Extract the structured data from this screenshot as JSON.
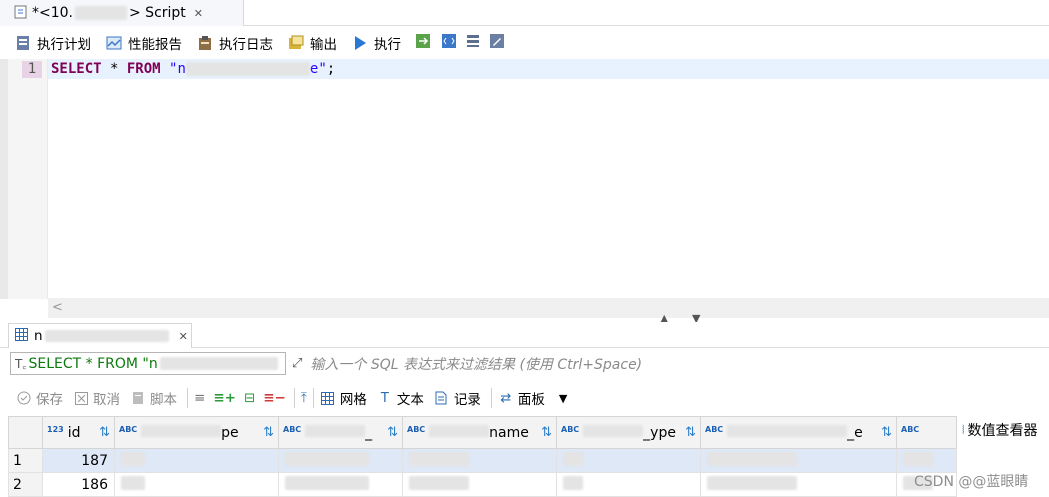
{
  "editor_tab": {
    "prefix": "*<10.",
    "suffix": "> Script",
    "close": "✕"
  },
  "toolbar": {
    "items": [
      {
        "label": "执行计划"
      },
      {
        "label": "性能报告"
      },
      {
        "label": "执行日志"
      },
      {
        "label": "输出"
      },
      {
        "label": "执行"
      }
    ]
  },
  "editor": {
    "line_number": "1",
    "code": {
      "kw1": "SELECT",
      "star": " * ",
      "kw2": "FROM",
      "q1": " \"n",
      "q2": "e\"",
      "semi": ";"
    }
  },
  "scroll": {
    "left_arrow": "<",
    "up": "▲",
    "down": "▼"
  },
  "result_tab": {
    "label_prefix": "n",
    "close": "✕"
  },
  "filter": {
    "text": "SELECT * FROM \"n",
    "placeholder": "输入一个 SQL 表达式来过滤结果 (使用 Ctrl+Space)"
  },
  "result_toolbar": {
    "save": "保存",
    "cancel": "取消",
    "script": "脚本",
    "grid": "网格",
    "text": "文本",
    "record": "记录",
    "panel": "面板"
  },
  "table": {
    "headers": [
      {
        "label": "id",
        "type": "123"
      },
      {
        "label": "pe",
        "type": "ABC"
      },
      {
        "label": "_",
        "type": "ABC"
      },
      {
        "label": "name",
        "type": "ABC"
      },
      {
        "label": "_ype",
        "type": "ABC"
      },
      {
        "label": "_e",
        "type": "ABC"
      },
      {
        "label": "",
        "type": "ABC"
      }
    ],
    "rows": [
      {
        "num": "1",
        "id": "187"
      },
      {
        "num": "2",
        "id": "186"
      }
    ]
  },
  "numviewer": {
    "label": "数值查看器"
  },
  "watermark": "CSDN @@蓝眼睛"
}
